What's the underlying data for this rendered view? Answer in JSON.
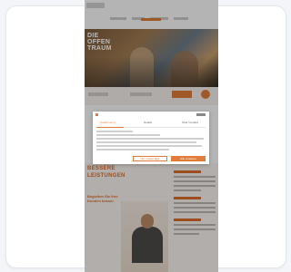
{
  "colors": {
    "accent": "#e07b39",
    "card_background": "#ffffff",
    "page_background": "#f3f5f8"
  },
  "hero": {
    "headline_lines": [
      "DIE",
      "OFFEN",
      "TRAUM"
    ]
  },
  "lower": {
    "title_line_1": "BESSERE",
    "title_line_2": "LEISTUNGEN",
    "subtitle": "Begleiten Sie Ihre Kunden besser"
  },
  "modal": {
    "tabs": [
      "Zustimmung",
      "Details",
      "Über Cookies"
    ],
    "button_outline_label": "Nur notwendige",
    "button_primary_label": "Alle zulassen"
  }
}
